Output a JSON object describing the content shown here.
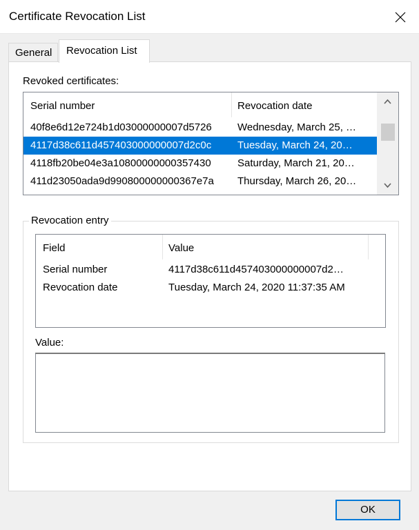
{
  "window": {
    "title": "Certificate Revocation List"
  },
  "tabs": [
    {
      "label": "General",
      "active": false
    },
    {
      "label": "Revocation List",
      "active": true
    }
  ],
  "revoked": {
    "label": "Revoked certificates:",
    "columns": [
      "Serial number",
      "Revocation date"
    ],
    "rows": [
      {
        "serial": "40f8e6d12e724b1d03000000007d5726",
        "date": "Wednesday, March 25, …",
        "selected": false
      },
      {
        "serial": "4117d38c611d457403000000007d2c0c",
        "date": "Tuesday, March 24, 20…",
        "selected": true
      },
      {
        "serial": "4118fb20be04e3a10800000000357430",
        "date": "Saturday, March 21, 20…",
        "selected": false
      },
      {
        "serial": "411d23050ada9d990800000000367e7a",
        "date": "Thursday, March 26, 20…",
        "selected": false
      }
    ]
  },
  "entry": {
    "group_label": "Revocation entry",
    "columns": [
      "Field",
      "Value"
    ],
    "rows": [
      {
        "field": "Serial number",
        "value": "4117d38c611d457403000000007d2…"
      },
      {
        "field": "Revocation date",
        "value": "Tuesday, March 24, 2020 11:37:35 AM"
      }
    ],
    "value_label": "Value:"
  },
  "buttons": {
    "ok": "OK"
  },
  "colors": {
    "selection": "#0078d7",
    "ok_border": "#0078d7"
  }
}
